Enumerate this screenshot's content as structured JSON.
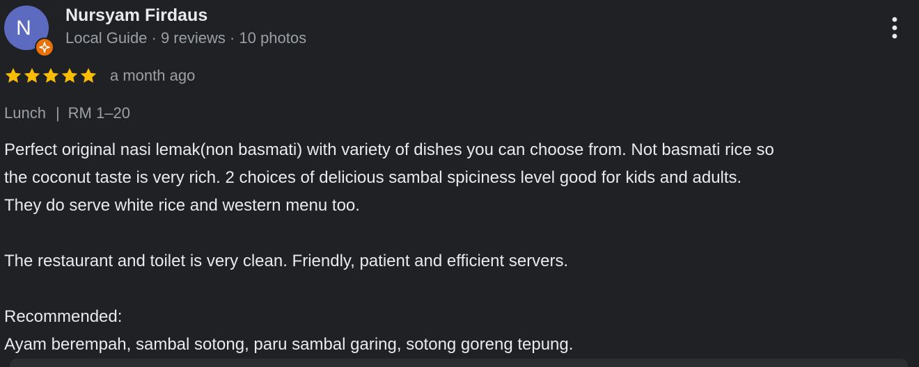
{
  "author": {
    "initial": "N",
    "name": "Nursyam Firdaus",
    "meta": "Local Guide · 9 reviews · 10 photos",
    "avatar_color": "#5c6bc0",
    "badge_color": "#e8710a",
    "badge_icon": "local-guide-badge-icon"
  },
  "rating": {
    "stars": 5,
    "max": 5,
    "star_color": "#fbbc04",
    "time": "a month ago"
  },
  "visit": {
    "meal": "Lunch",
    "separator": "|",
    "price": "RM 1–20"
  },
  "body": {
    "line1": "Perfect original nasi lemak(non basmati) with variety of dishes you can choose from. Not basmati rice so",
    "line2": "the coconut taste is very rich. 2 choices of delicious sambal spiciness level good for kids and adults.",
    "line3": "They do serve white rice and western menu too.",
    "line4": "The restaurant and toilet is very clean. Friendly, patient and efficient servers.",
    "line5": "Recommended:",
    "line6": "Ayam berempah, sambal sotong, paru sambal garing, sotong goreng tepung."
  },
  "actions": {
    "more_icon": "more-vert-icon"
  }
}
